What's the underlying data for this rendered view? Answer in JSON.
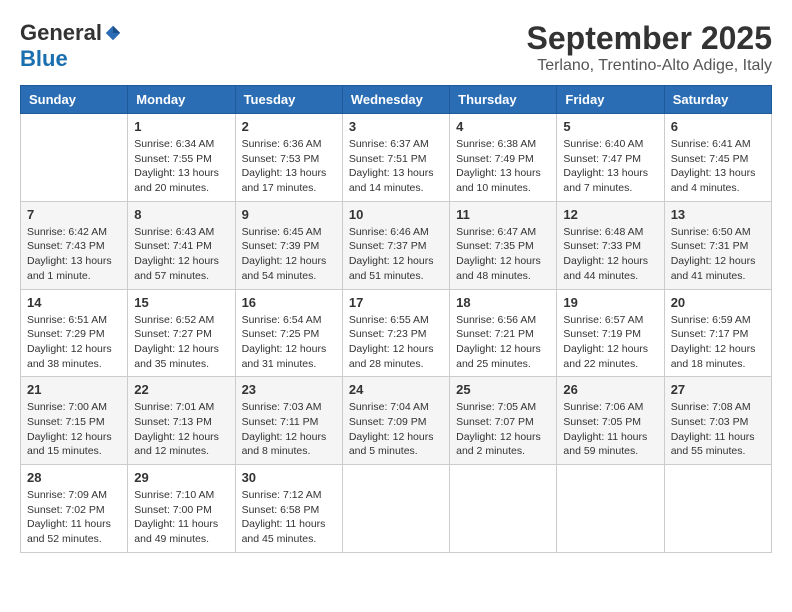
{
  "header": {
    "logo": {
      "general": "General",
      "blue": "Blue"
    },
    "title": "September 2025",
    "location": "Terlano, Trentino-Alto Adige, Italy"
  },
  "days_of_week": [
    "Sunday",
    "Monday",
    "Tuesday",
    "Wednesday",
    "Thursday",
    "Friday",
    "Saturday"
  ],
  "weeks": [
    {
      "cells": [
        {
          "day": "",
          "info": []
        },
        {
          "day": "1",
          "info": [
            "Sunrise: 6:34 AM",
            "Sunset: 7:55 PM",
            "Daylight: 13 hours",
            "and 20 minutes."
          ]
        },
        {
          "day": "2",
          "info": [
            "Sunrise: 6:36 AM",
            "Sunset: 7:53 PM",
            "Daylight: 13 hours",
            "and 17 minutes."
          ]
        },
        {
          "day": "3",
          "info": [
            "Sunrise: 6:37 AM",
            "Sunset: 7:51 PM",
            "Daylight: 13 hours",
            "and 14 minutes."
          ]
        },
        {
          "day": "4",
          "info": [
            "Sunrise: 6:38 AM",
            "Sunset: 7:49 PM",
            "Daylight: 13 hours",
            "and 10 minutes."
          ]
        },
        {
          "day": "5",
          "info": [
            "Sunrise: 6:40 AM",
            "Sunset: 7:47 PM",
            "Daylight: 13 hours",
            "and 7 minutes."
          ]
        },
        {
          "day": "6",
          "info": [
            "Sunrise: 6:41 AM",
            "Sunset: 7:45 PM",
            "Daylight: 13 hours",
            "and 4 minutes."
          ]
        }
      ],
      "shaded": false
    },
    {
      "cells": [
        {
          "day": "7",
          "info": [
            "Sunrise: 6:42 AM",
            "Sunset: 7:43 PM",
            "Daylight: 13 hours",
            "and 1 minute."
          ]
        },
        {
          "day": "8",
          "info": [
            "Sunrise: 6:43 AM",
            "Sunset: 7:41 PM",
            "Daylight: 12 hours",
            "and 57 minutes."
          ]
        },
        {
          "day": "9",
          "info": [
            "Sunrise: 6:45 AM",
            "Sunset: 7:39 PM",
            "Daylight: 12 hours",
            "and 54 minutes."
          ]
        },
        {
          "day": "10",
          "info": [
            "Sunrise: 6:46 AM",
            "Sunset: 7:37 PM",
            "Daylight: 12 hours",
            "and 51 minutes."
          ]
        },
        {
          "day": "11",
          "info": [
            "Sunrise: 6:47 AM",
            "Sunset: 7:35 PM",
            "Daylight: 12 hours",
            "and 48 minutes."
          ]
        },
        {
          "day": "12",
          "info": [
            "Sunrise: 6:48 AM",
            "Sunset: 7:33 PM",
            "Daylight: 12 hours",
            "and 44 minutes."
          ]
        },
        {
          "day": "13",
          "info": [
            "Sunrise: 6:50 AM",
            "Sunset: 7:31 PM",
            "Daylight: 12 hours",
            "and 41 minutes."
          ]
        }
      ],
      "shaded": true
    },
    {
      "cells": [
        {
          "day": "14",
          "info": [
            "Sunrise: 6:51 AM",
            "Sunset: 7:29 PM",
            "Daylight: 12 hours",
            "and 38 minutes."
          ]
        },
        {
          "day": "15",
          "info": [
            "Sunrise: 6:52 AM",
            "Sunset: 7:27 PM",
            "Daylight: 12 hours",
            "and 35 minutes."
          ]
        },
        {
          "day": "16",
          "info": [
            "Sunrise: 6:54 AM",
            "Sunset: 7:25 PM",
            "Daylight: 12 hours",
            "and 31 minutes."
          ]
        },
        {
          "day": "17",
          "info": [
            "Sunrise: 6:55 AM",
            "Sunset: 7:23 PM",
            "Daylight: 12 hours",
            "and 28 minutes."
          ]
        },
        {
          "day": "18",
          "info": [
            "Sunrise: 6:56 AM",
            "Sunset: 7:21 PM",
            "Daylight: 12 hours",
            "and 25 minutes."
          ]
        },
        {
          "day": "19",
          "info": [
            "Sunrise: 6:57 AM",
            "Sunset: 7:19 PM",
            "Daylight: 12 hours",
            "and 22 minutes."
          ]
        },
        {
          "day": "20",
          "info": [
            "Sunrise: 6:59 AM",
            "Sunset: 7:17 PM",
            "Daylight: 12 hours",
            "and 18 minutes."
          ]
        }
      ],
      "shaded": false
    },
    {
      "cells": [
        {
          "day": "21",
          "info": [
            "Sunrise: 7:00 AM",
            "Sunset: 7:15 PM",
            "Daylight: 12 hours",
            "and 15 minutes."
          ]
        },
        {
          "day": "22",
          "info": [
            "Sunrise: 7:01 AM",
            "Sunset: 7:13 PM",
            "Daylight: 12 hours",
            "and 12 minutes."
          ]
        },
        {
          "day": "23",
          "info": [
            "Sunrise: 7:03 AM",
            "Sunset: 7:11 PM",
            "Daylight: 12 hours",
            "and 8 minutes."
          ]
        },
        {
          "day": "24",
          "info": [
            "Sunrise: 7:04 AM",
            "Sunset: 7:09 PM",
            "Daylight: 12 hours",
            "and 5 minutes."
          ]
        },
        {
          "day": "25",
          "info": [
            "Sunrise: 7:05 AM",
            "Sunset: 7:07 PM",
            "Daylight: 12 hours",
            "and 2 minutes."
          ]
        },
        {
          "day": "26",
          "info": [
            "Sunrise: 7:06 AM",
            "Sunset: 7:05 PM",
            "Daylight: 11 hours",
            "and 59 minutes."
          ]
        },
        {
          "day": "27",
          "info": [
            "Sunrise: 7:08 AM",
            "Sunset: 7:03 PM",
            "Daylight: 11 hours",
            "and 55 minutes."
          ]
        }
      ],
      "shaded": true
    },
    {
      "cells": [
        {
          "day": "28",
          "info": [
            "Sunrise: 7:09 AM",
            "Sunset: 7:02 PM",
            "Daylight: 11 hours",
            "and 52 minutes."
          ]
        },
        {
          "day": "29",
          "info": [
            "Sunrise: 7:10 AM",
            "Sunset: 7:00 PM",
            "Daylight: 11 hours",
            "and 49 minutes."
          ]
        },
        {
          "day": "30",
          "info": [
            "Sunrise: 7:12 AM",
            "Sunset: 6:58 PM",
            "Daylight: 11 hours",
            "and 45 minutes."
          ]
        },
        {
          "day": "",
          "info": []
        },
        {
          "day": "",
          "info": []
        },
        {
          "day": "",
          "info": []
        },
        {
          "day": "",
          "info": []
        }
      ],
      "shaded": false
    }
  ]
}
